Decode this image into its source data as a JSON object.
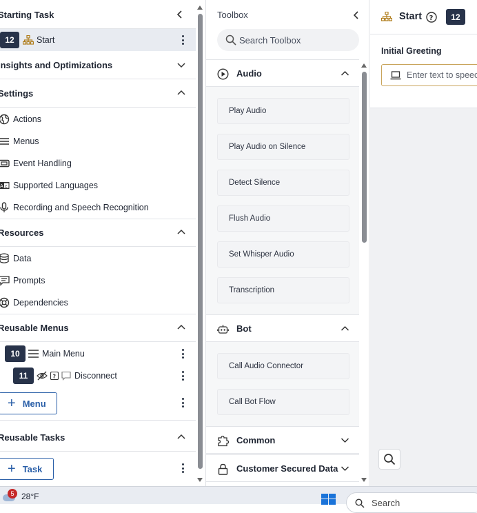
{
  "left": {
    "starting_task": {
      "title": "Starting Task"
    },
    "start_row": {
      "badge": "12",
      "label": "Start"
    },
    "insights": {
      "title": "Insights and Optimizations"
    },
    "settings": {
      "title": "Settings",
      "items": [
        {
          "label": "Actions"
        },
        {
          "label": "Menus"
        },
        {
          "label": "Event Handling"
        },
        {
          "label": "Supported Languages"
        },
        {
          "label": "Recording and Speech Recognition"
        }
      ]
    },
    "resources": {
      "title": "Resources",
      "items": [
        {
          "label": "Data"
        },
        {
          "label": "Prompts"
        },
        {
          "label": "Dependencies"
        }
      ]
    },
    "reusable_menus": {
      "title": "Reusable Menus",
      "main_menu": {
        "badge": "10",
        "label": "Main Menu"
      },
      "disconnect": {
        "badge": "11",
        "label": "Disconnect"
      },
      "add_label": "Menu"
    },
    "reusable_tasks": {
      "title": "Reusable Tasks",
      "add_label": "Task"
    }
  },
  "toolbox": {
    "title": "Toolbox",
    "search_placeholder": "Search Toolbox",
    "categories": {
      "audio": {
        "title": "Audio",
        "items": [
          "Play Audio",
          "Play Audio on Silence",
          "Detect Silence",
          "Flush Audio",
          "Set Whisper Audio",
          "Transcription"
        ]
      },
      "bot": {
        "title": "Bot",
        "items": [
          "Call Audio Connector",
          "Call Bot Flow"
        ]
      },
      "common": {
        "title": "Common"
      },
      "customer_secured": {
        "title": "Customer Secured Data"
      }
    }
  },
  "right": {
    "title": "Start",
    "badge": "12",
    "greeting_label": "Initial Greeting",
    "greeting_placeholder": "Enter text to speech"
  },
  "taskbar": {
    "notification_count": "5",
    "temperature": "28°F",
    "search_placeholder": "Search"
  },
  "colors": {
    "badge": "#28334a",
    "accent": "#2a5fa8",
    "input_border": "#c9a55b",
    "start_row_bg": "#e8ebf1"
  }
}
